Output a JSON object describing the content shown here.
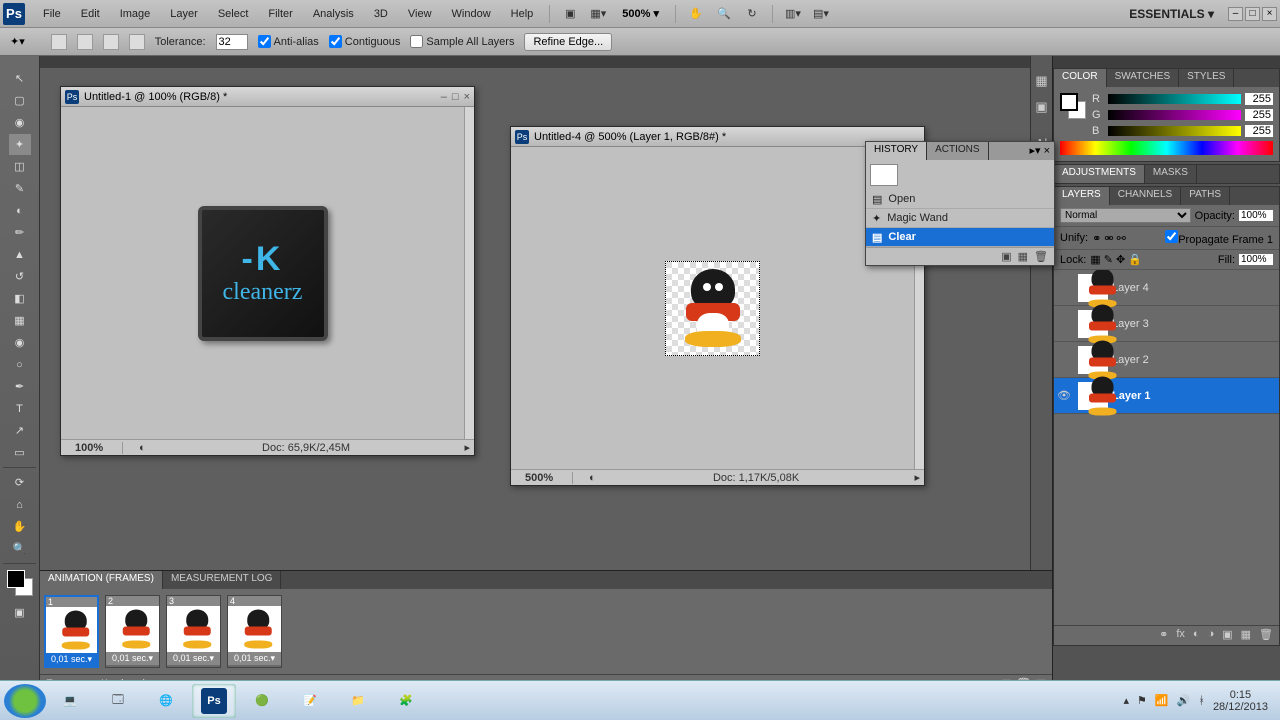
{
  "menubar": {
    "items": [
      "File",
      "Edit",
      "Image",
      "Layer",
      "Select",
      "Filter",
      "Analysis",
      "3D",
      "View",
      "Window",
      "Help"
    ],
    "zoom": "500% ▾",
    "workspace": "ESSENTIALS ▾"
  },
  "optbar": {
    "tolerance_label": "Tolerance:",
    "tolerance": "32",
    "antialias": "Anti-alias",
    "contiguous": "Contiguous",
    "sampleall": "Sample All Layers",
    "refine": "Refine Edge..."
  },
  "docs": {
    "d1": {
      "title": "Untitled-1 @ 100% (RGB/8) *",
      "zoom": "100%",
      "info": "Doc: 65,9K/2,45M",
      "logo_k": "-K",
      "logo_text": "cleanerz"
    },
    "d2": {
      "title": "Untitled-4 @ 500% (Layer 1, RGB/8#) *",
      "zoom": "500%",
      "info": "Doc: 1,17K/5,08K"
    }
  },
  "history": {
    "tab1": "HISTORY",
    "tab2": "ACTIONS",
    "items": [
      "Open",
      "Magic Wand",
      "Clear"
    ]
  },
  "color": {
    "tab1": "COLOR",
    "tab2": "SWATCHES",
    "tab3": "STYLES",
    "R": "255",
    "G": "255",
    "B": "255"
  },
  "adj": {
    "tab1": "ADJUSTMENTS",
    "tab2": "MASKS"
  },
  "layers": {
    "tab1": "LAYERS",
    "tab2": "CHANNELS",
    "tab3": "PATHS",
    "blend": "Normal",
    "opacity_label": "Opacity:",
    "opacity": "100%",
    "unify": "Unify:",
    "propagate": "Propagate Frame 1",
    "lock": "Lock:",
    "fill_label": "Fill:",
    "fill": "100%",
    "items": [
      "Layer 4",
      "Layer 3",
      "Layer 2",
      "Layer 1"
    ]
  },
  "anim": {
    "tab1": "ANIMATION (FRAMES)",
    "tab2": "MEASUREMENT LOG",
    "time": "0,01 sec.▾",
    "loop": "Forever ▾"
  },
  "taskbar": {
    "time": "0:15",
    "date": "28/12/2013"
  }
}
